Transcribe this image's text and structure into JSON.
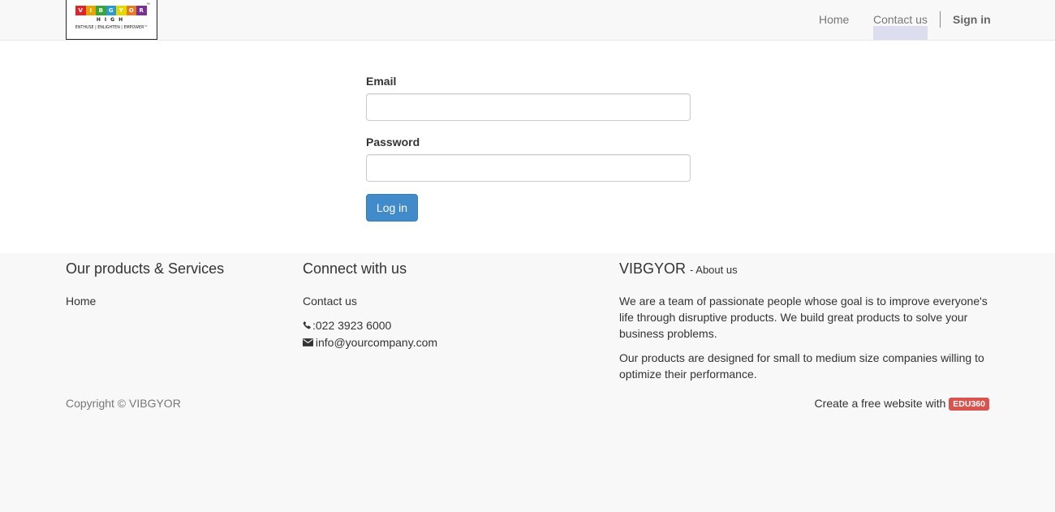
{
  "logo": {
    "letters": [
      "V",
      "I",
      "B",
      "G",
      "Y",
      "O",
      "R"
    ],
    "colors": [
      "#e0242b",
      "#e8a400",
      "#3aa537",
      "#2a9ad6",
      "#e5d800",
      "#e77b1f",
      "#7a2f93"
    ],
    "tm": "™",
    "sub": "HIGH",
    "tagline": "ENTHUSE | ENLIGHTEN | EMPOWER™"
  },
  "nav": {
    "home": "Home",
    "contact": "Contact us",
    "signin": "Sign in"
  },
  "form": {
    "email_label": "Email",
    "email_value": "",
    "password_label": "Password",
    "password_value": "",
    "login_label": "Log in"
  },
  "footer": {
    "products": {
      "title": "Our products & Services",
      "home": "Home"
    },
    "connect": {
      "title": "Connect with us",
      "contact": "Contact us",
      "phone": ":022 3923 6000",
      "email": "info@yourcompany.com",
      "phone_icon": "phone-icon",
      "email_icon": "envelope-icon"
    },
    "about": {
      "brand": "VIBGYOR",
      "subtitle": "- About us",
      "p1": "We are a team of passionate people whose goal is to improve everyone's life through disruptive products. We build great products to solve your business problems.",
      "p2": "Our products are designed for small to medium size companies willing to optimize their performance."
    },
    "copyright": "Copyright © VIBGYOR",
    "powered_text": "Create a free website with",
    "powered_badge": "EDU360",
    "badge_color": "#d9534f"
  }
}
